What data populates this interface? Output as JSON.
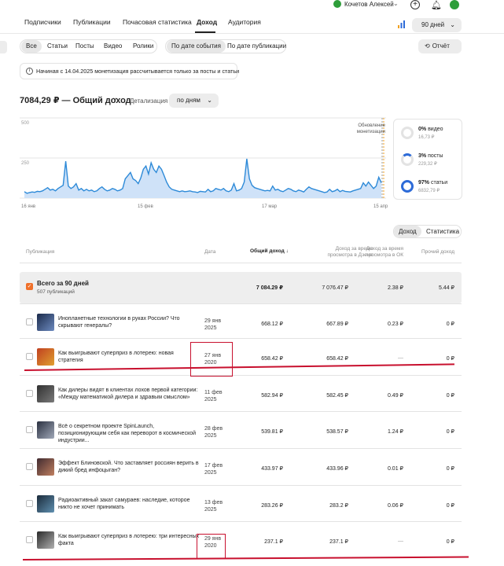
{
  "header": {
    "user_name": "Кочетов Алексей",
    "tabs": [
      {
        "label": "Подписчики"
      },
      {
        "label": "Публикации"
      },
      {
        "label": "Почасовая статистика"
      },
      {
        "label": "Доход"
      },
      {
        "label": "Аудитория"
      }
    ],
    "period": "90 дней"
  },
  "filters": {
    "type_tabs": [
      "Все",
      "Статьи",
      "Посты",
      "Видео",
      "Ролики"
    ],
    "date_tabs": [
      "По дате события",
      "По дате публикации"
    ],
    "report_label": "Отчёт"
  },
  "notice": "Начиная с 14.04.2025 монетизация рассчитывается только за посты и статьи",
  "summary": {
    "total": "7084,29 ₽ — Общий доход",
    "detail_label": "Детализация",
    "detail_value": "по дням"
  },
  "chart_data": {
    "type": "area",
    "x_ticks": [
      "16 янв",
      "15 фев",
      "17 мар",
      "15 апр"
    ],
    "y_ticks": [
      "500",
      "250",
      "0"
    ],
    "ylim": [
      0,
      500
    ],
    "annotation": "Обновление монетизации",
    "values": [
      40,
      30,
      35,
      38,
      36,
      42,
      40,
      45,
      55,
      65,
      50,
      55,
      45,
      60,
      70,
      80,
      230,
      75,
      60,
      70,
      90,
      50,
      60,
      45,
      55,
      45,
      50,
      40,
      45,
      60,
      70,
      55,
      45,
      50,
      60,
      55,
      45,
      50,
      60,
      120,
      140,
      160,
      120,
      110,
      90,
      125,
      180,
      200,
      150,
      220,
      180,
      160,
      200,
      180,
      140,
      100,
      70,
      55,
      50,
      45,
      40,
      45,
      40,
      42,
      45,
      40,
      38,
      35,
      42,
      40,
      38,
      55,
      40,
      45,
      60,
      55,
      50,
      60,
      45,
      40,
      50,
      90,
      45,
      50,
      60,
      100,
      245,
      120,
      80,
      65,
      60,
      55,
      50,
      45,
      48,
      45,
      75,
      50,
      55,
      45,
      40,
      50,
      60,
      55,
      45,
      40,
      50,
      45,
      38,
      55,
      70,
      60,
      55,
      50,
      45,
      40,
      35,
      38,
      55,
      40,
      45,
      55,
      40,
      48,
      42,
      40,
      38,
      45,
      50,
      55,
      60,
      95,
      75,
      100,
      80,
      60,
      75,
      130,
      95
    ],
    "breakdown": [
      {
        "pct": "0%",
        "label": "видео",
        "amount": "16,73 ₽"
      },
      {
        "pct": "3%",
        "label": "посты",
        "amount": "229,32 ₽"
      },
      {
        "pct": "97%",
        "label": "статьи",
        "amount": "6832,79 ₽"
      }
    ]
  },
  "toggle": {
    "a": "Доход",
    "b": "Статистика"
  },
  "table": {
    "headers": {
      "pub": "Публикация",
      "date": "Дата",
      "total": "Общий доход",
      "dzen": "Доход за время просмотра в Дзене",
      "ok": "Доход за время просмотра в ОК",
      "other": "Прочий доход"
    },
    "total_row": {
      "title": "Всего за 90 дней",
      "sub": "507 публикаций",
      "total": "7 084.29 ₽",
      "dzen": "7 076.47 ₽",
      "ok": "2.38 ₽",
      "other": "5.44 ₽"
    },
    "rows": [
      {
        "title": "Инопланетные технологии в руках России? Что скрывают генералы?",
        "date1": "29 янв",
        "date2": "2025",
        "total": "668.12 ₽",
        "dzen": "667.89 ₽",
        "ok": "0.23 ₽",
        "other": "0 ₽"
      },
      {
        "title": "Как выигрывают суперприз в лотерею: новая стратегия",
        "date1": "27 янв",
        "date2": "2020",
        "total": "658.42 ₽",
        "dzen": "658.42 ₽",
        "ok": "—",
        "other": "0 ₽"
      },
      {
        "title": "Как дилеры видят в клиентах лохов первой категории: «Между математикой дилера и здравым смыслом»",
        "date1": "11 фев",
        "date2": "2025",
        "total": "582.94 ₽",
        "dzen": "582.45 ₽",
        "ok": "0.49 ₽",
        "other": "0 ₽"
      },
      {
        "title": "Всё о секретном проекте SpinLaunch, позиционирующим себя как переворот в космической индустрии...",
        "date1": "28 фев",
        "date2": "2025",
        "total": "539.81 ₽",
        "dzen": "538.57 ₽",
        "ok": "1.24 ₽",
        "other": "0 ₽"
      },
      {
        "title": "Эффект Блиновской. Что заставляет россиян верить в дикий бред инфоцыган?",
        "date1": "17 фев",
        "date2": "2025",
        "total": "433.97 ₽",
        "dzen": "433.96 ₽",
        "ok": "0.01 ₽",
        "other": "0 ₽"
      },
      {
        "title": "Радиоактивный закат самураев: наследие, которое никто не хочет принимать",
        "date1": "13 фев",
        "date2": "2025",
        "total": "283.26 ₽",
        "dzen": "283.2 ₽",
        "ok": "0.06 ₽",
        "other": "0 ₽"
      },
      {
        "title": "Как выигрывают суперприз в лотерею: три интересных факта",
        "date1": "29 янв",
        "date2": "2020",
        "total": "237.1 ₽",
        "dzen": "237.1 ₽",
        "ok": "—",
        "other": "0 ₽"
      }
    ]
  }
}
